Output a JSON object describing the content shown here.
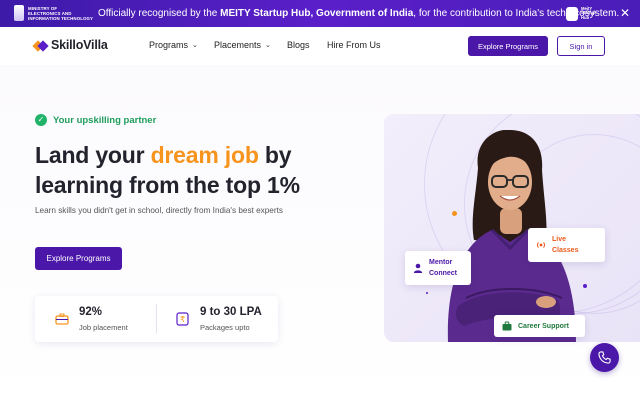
{
  "banner": {
    "ministry_text": "MINISTRY OF\nELECTRONICS AND\nINFORMATION TECHNOLOGY",
    "message_prefix": "Officially recognised by the ",
    "message_bold": "MEITY Startup Hub, Government of India",
    "message_suffix": ", for the contribution to India's tech ecosystem.",
    "startup_logo_text": "MeitY\nStartup\nHub",
    "close_label": "✕",
    "background_color": "#4a1db8"
  },
  "nav": {
    "logo_text": "SkilloVilla",
    "items": [
      {
        "label": "Programs",
        "has_dropdown": true
      },
      {
        "label": "Placements",
        "has_dropdown": true
      },
      {
        "label": "Blogs",
        "has_dropdown": false
      },
      {
        "label": "Hire From Us",
        "has_dropdown": false
      }
    ],
    "explore_label": "Explore Programs",
    "signin_label": "Sign in"
  },
  "hero": {
    "tagline": "Your upskilling partner",
    "headline_part1": "Land your ",
    "headline_highlight": "dream job",
    "headline_part2": " by learning from the top 1%",
    "subtext": "Learn skills you didn't get in school, directly from India's best experts",
    "cta_label": "Explore Programs",
    "stats": [
      {
        "value": "92%",
        "label": "Job placement",
        "icon": "briefcase-icon"
      },
      {
        "value": "9 to 30 LPA",
        "label": "Packages upto",
        "icon": "rupee-icon"
      }
    ],
    "float_cards": [
      {
        "label": "Mentor\nConnect",
        "icon": "person-icon",
        "color": "#4a17a8"
      },
      {
        "label": "Live\nClasses",
        "icon": "broadcast-icon",
        "color": "#e8591a"
      },
      {
        "label": "Career Support",
        "icon": "briefcase-icon",
        "color": "#1f7a3c"
      }
    ]
  },
  "colors": {
    "brand_purple": "#4a17a8",
    "accent_orange": "#f7941d",
    "success_green": "#22b36b"
  },
  "fab": {
    "icon": "phone-icon"
  }
}
